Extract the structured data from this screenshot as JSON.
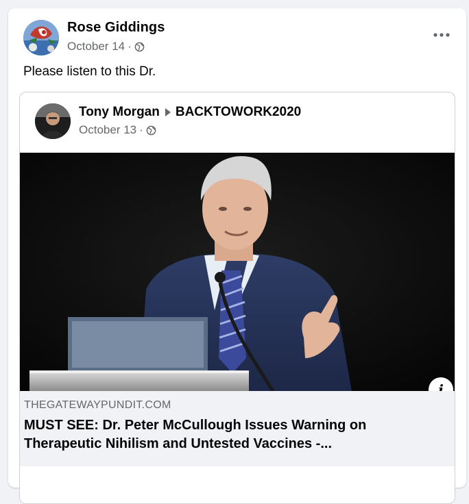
{
  "post": {
    "author": "Rose Giddings",
    "date": "October 14",
    "separator": "·",
    "privacy_icon": "globe-icon",
    "text": "Please listen to this Dr."
  },
  "shared_post": {
    "author": "Tony Morgan",
    "group": "BACKTOWORK2020",
    "date": "October 13",
    "separator": "·",
    "privacy_icon": "globe-icon"
  },
  "link_preview": {
    "domain": "THEGATEWAYPUNDIT.COM",
    "headline": "MUST SEE: Dr. Peter McCullough Issues Warning on Therapeutic Nihilism and Untested Vaccines -...",
    "info_label": "i"
  },
  "colors": {
    "background": "#f0f2f5",
    "card": "#ffffff",
    "secondary_text": "#65676b",
    "primary_text": "#050505"
  }
}
